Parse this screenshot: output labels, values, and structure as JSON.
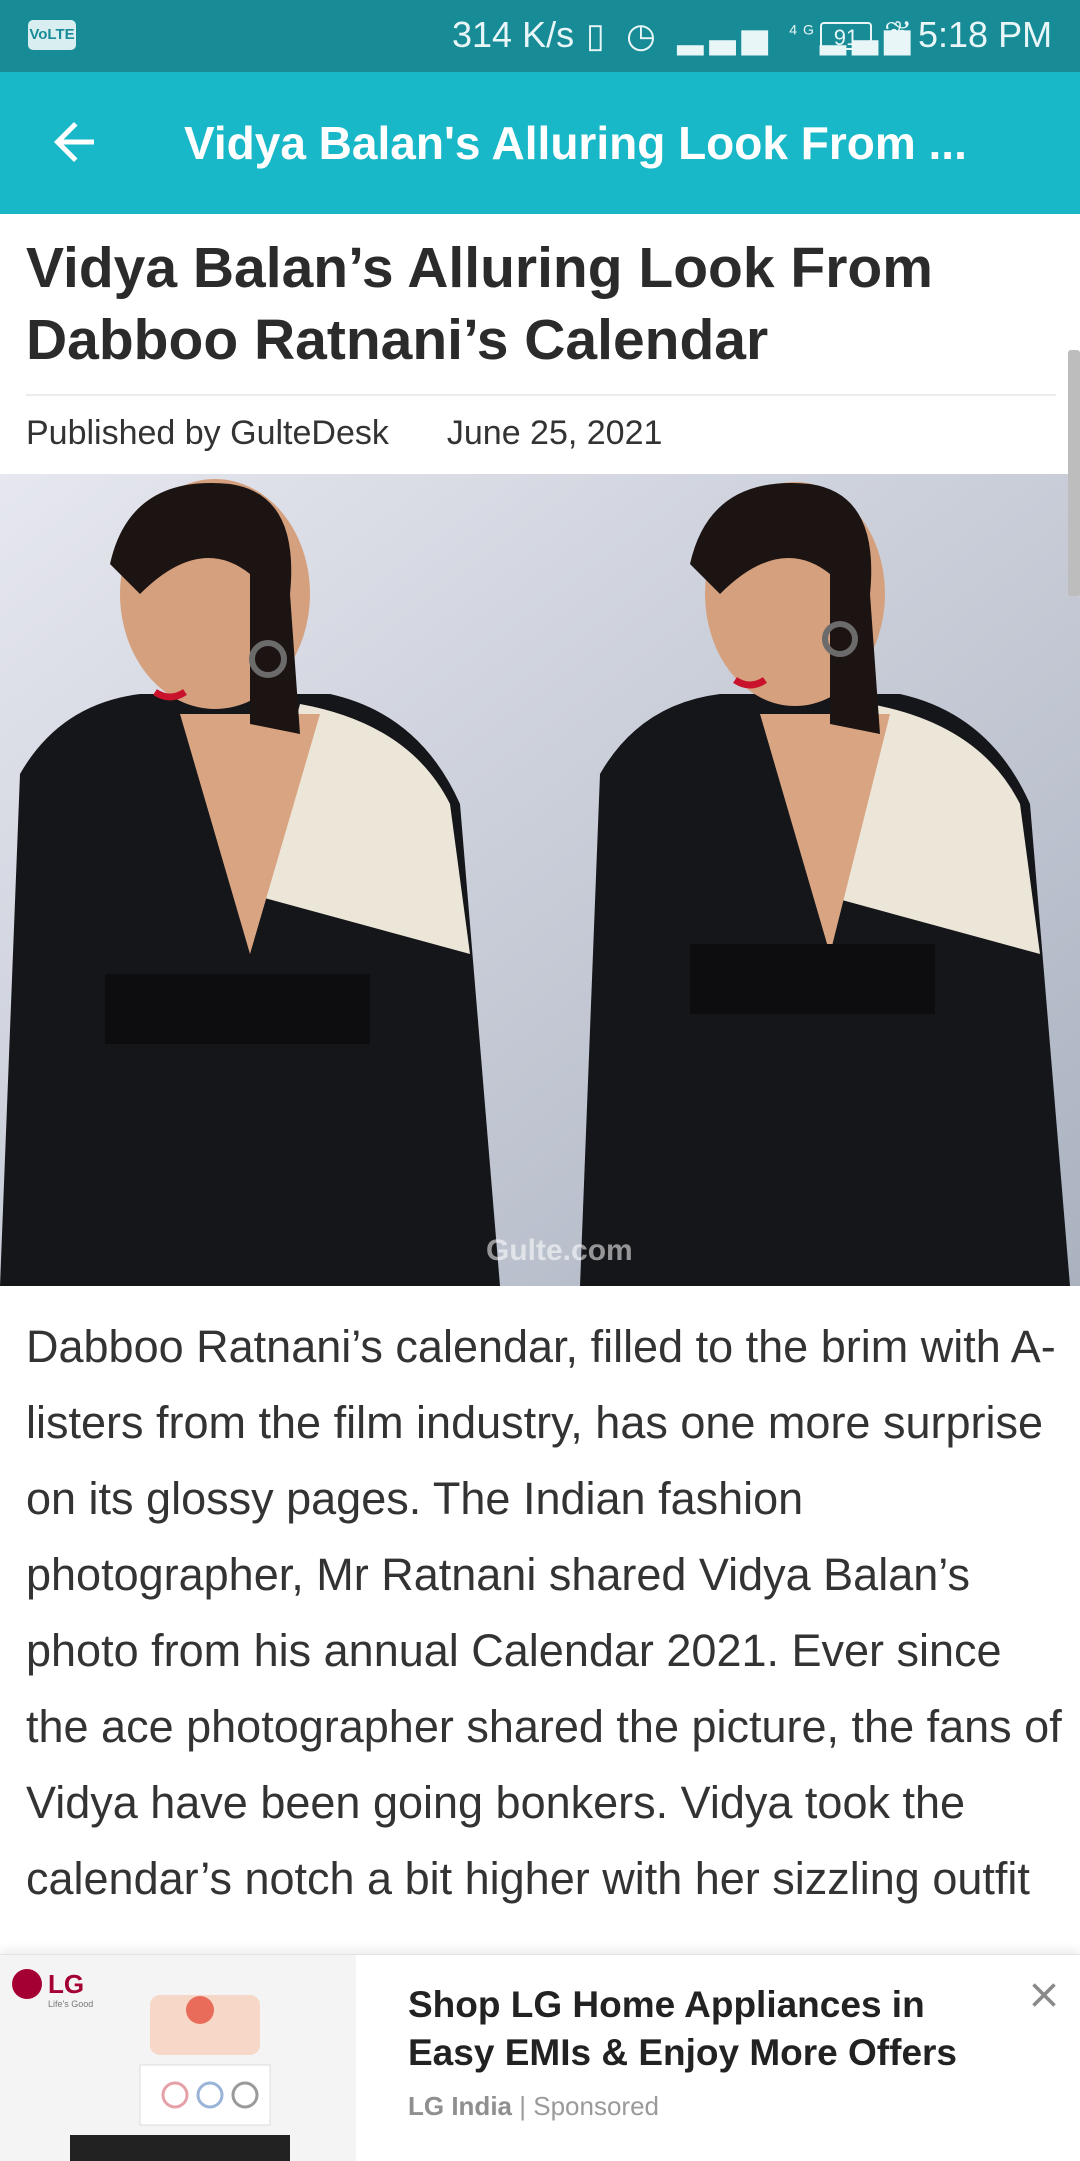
{
  "status_bar": {
    "network_badge": "VoLTE",
    "speed": "314 K/s",
    "signal_label": "4G",
    "battery": "91",
    "time": "5:18 PM",
    "icons": [
      "vibrate-icon",
      "alarm-icon",
      "signal-icon",
      "signal-4g-icon",
      "battery-icon",
      "leaf-icon"
    ]
  },
  "app_bar": {
    "title": "Vidya Balan's Alluring Look From ...",
    "back_icon": "arrow-left-icon"
  },
  "article": {
    "headline": "Vidya Balan’s Alluring Look From Dabboo Ratnani’s Calendar",
    "publisher": "Published by GulteDesk",
    "date": "June 25, 2021",
    "image_watermark": "Gulte.com",
    "body": "Dabboo Ratnani’s calendar, filled to the brim with A-listers from the film industry, has one more surprise on its glossy pages. The Indian fashion photographer, Mr Ratnani shared Vidya Balan’s photo from his annual Calendar 2021. Ever since the ace photographer shared the picture, the fans of Vidya have been going bonkers. Vidya took the calendar’s notch a bit higher with her sizzling outfit"
  },
  "ad": {
    "brand_logo": "LG",
    "brand_tagline": "Life's Good",
    "headline": "Shop LG Home Appliances in Easy EMIs & Enjoy More Offers",
    "advertiser": "LG India",
    "separator": "|",
    "label": "Sponsored",
    "close_icon": "close-icon"
  },
  "colors": {
    "status_bar": "#178b96",
    "app_bar": "#19b8c8",
    "lg_brand": "#a50034"
  }
}
